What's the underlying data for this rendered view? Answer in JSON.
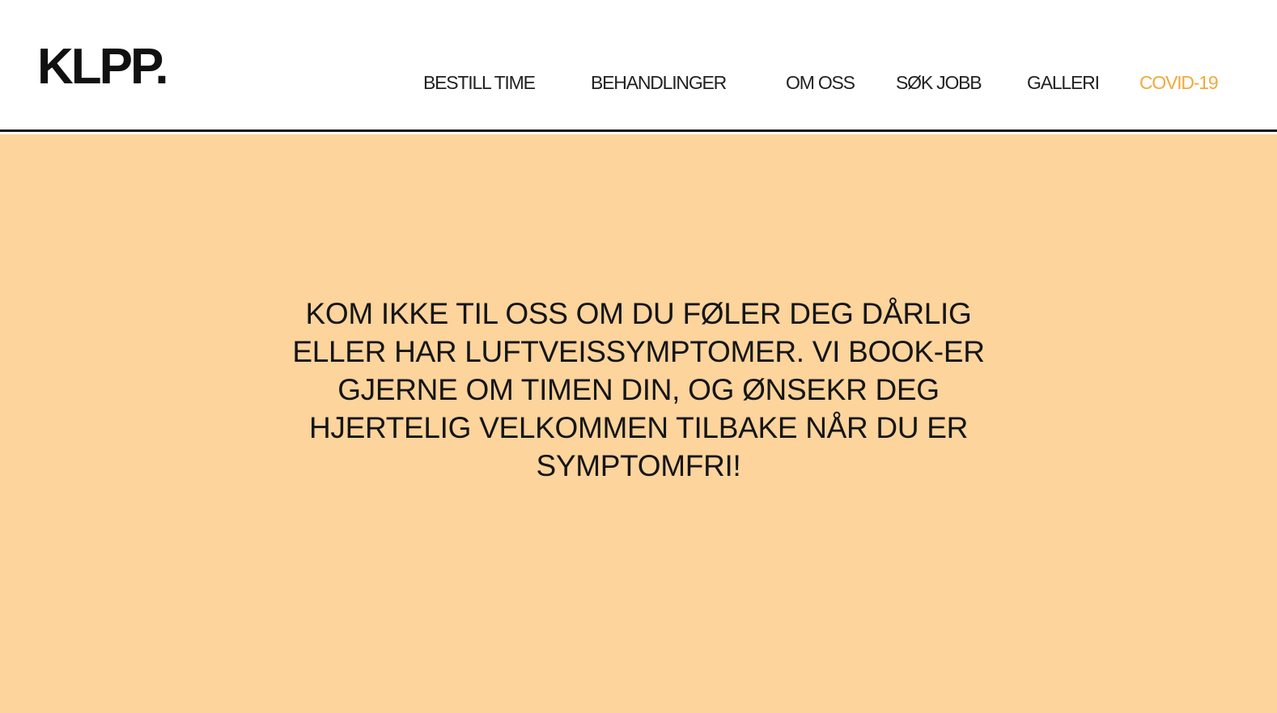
{
  "header": {
    "logo": "KLPP."
  },
  "nav": {
    "items": [
      {
        "label": "BESTILL TIME"
      },
      {
        "label": "BEHANDLINGER"
      },
      {
        "label": "OM OSS"
      },
      {
        "label": "SØK JOBB"
      },
      {
        "label": "GALLERI"
      },
      {
        "label": "COVID-19",
        "active": true
      }
    ]
  },
  "hero": {
    "message": "KOM IKKE TIL OSS OM DU FØLER DEG DÅRLIG ELLER HAR LUFTVEISSYMPTOMER. VI BOOK-ER GJERNE OM TIMEN DIN, OG ØNSEKR DEG HJERTELIG VELKOMMEN TILBAKE NÅR DU ER SYMPTOMFRI!"
  },
  "colors": {
    "hero_background": "#fcd49c",
    "active_nav": "#f2a93b",
    "text": "#111111"
  }
}
